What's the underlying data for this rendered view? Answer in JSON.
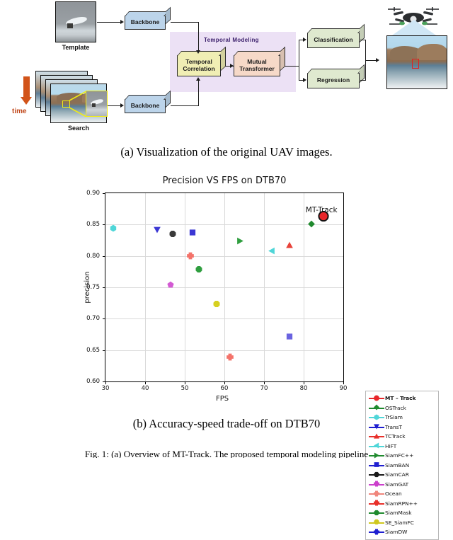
{
  "figure": {
    "panel_a_caption": "(a) Visualization of the original UAV images.",
    "panel_b_caption": "(b) Accuracy-speed trade-off on DTB70",
    "bottom_caption": "Fig. 1: (a) Overview of MT-Track. The proposed temporal modeling pipeline"
  },
  "diagram": {
    "template_label": "Template",
    "search_label": "Search",
    "time_label": "time",
    "backbone_top_label": "Backbone",
    "backbone_bottom_label": "Backbone",
    "temporal_modeling_title": "Temporal  Modeling",
    "temporal_correlation_label": "Temporal\nCorrelation",
    "mutual_transformer_label": "Mutual\nTransformer",
    "classification_label": "Classification",
    "regression_label": "Regression",
    "colors": {
      "backbone": "#bcd4ea",
      "temporal_correlation": "#f0eeb4",
      "mutual_transformer": "#f6d9c8",
      "head": "#dfe9cf",
      "temporal_panel": "#ece1f5",
      "time_arrow": "#d2541a",
      "crop_box": "#f2ec12",
      "target_box": "#e02020"
    }
  },
  "chart_data": {
    "type": "scatter",
    "title": "Precision VS FPS on DTB70",
    "xlabel": "FPS",
    "ylabel": "precision",
    "xlim": [
      30,
      90
    ],
    "ylim": [
      0.6,
      0.9
    ],
    "xticks": [
      30,
      40,
      50,
      60,
      70,
      80,
      90
    ],
    "yticks": [
      0.6,
      0.65,
      0.7,
      0.75,
      0.8,
      0.85,
      0.9
    ],
    "grid": true,
    "legend_position": "right-outside",
    "annotations": [
      {
        "text": "MT-Track",
        "x": 84.5,
        "y": 0.872
      }
    ],
    "highlight": {
      "name": "MT - Track",
      "outline": "#111111"
    },
    "points": [
      {
        "name": "MT - Track",
        "x": 85.0,
        "y": 0.861,
        "color": "#e8262a",
        "marker": "circle",
        "highlighted": true
      },
      {
        "name": "OSTrack",
        "x": 82.0,
        "y": 0.849,
        "color": "#1f8a2e",
        "marker": "diamond"
      },
      {
        "name": "TrSiam",
        "x": 32.0,
        "y": 0.842,
        "color": "#4fd6d8",
        "marker": "hexagon"
      },
      {
        "name": "TransT",
        "x": 43.0,
        "y": 0.84,
        "color": "#3b37d4",
        "marker": "triangle-down"
      },
      {
        "name": "TCTrack",
        "x": 76.5,
        "y": 0.815,
        "color": "#e8433a",
        "marker": "triangle-up"
      },
      {
        "name": "HiFT",
        "x": 72.0,
        "y": 0.806,
        "color": "#4fd6d8",
        "marker": "triangle-left"
      },
      {
        "name": "SiamFC++",
        "x": 64.0,
        "y": 0.822,
        "color": "#2f9e3f",
        "marker": "triangle-right"
      },
      {
        "name": "SiamBAN",
        "x": 52.0,
        "y": 0.836,
        "color": "#3b37d4",
        "marker": "square"
      },
      {
        "name": "SiamCAR",
        "x": 47.0,
        "y": 0.834,
        "color": "#3a3a3a",
        "marker": "octagon"
      },
      {
        "name": "SiamGAT",
        "x": 46.5,
        "y": 0.752,
        "color": "#d35ad3",
        "marker": "pentagon"
      },
      {
        "name": "Ocean",
        "x": 51.5,
        "y": 0.798,
        "color": "#f4726a",
        "marker": "plus-filled"
      },
      {
        "name": "SiamRPN++",
        "x": 61.5,
        "y": 0.637,
        "color": "#f4726a",
        "marker": "plus-filled"
      },
      {
        "name": "SiamMask",
        "x": 53.5,
        "y": 0.777,
        "color": "#2f9e3f",
        "marker": "octagon"
      },
      {
        "name": "SE_SiamFC",
        "x": 58.0,
        "y": 0.722,
        "color": "#d6d020",
        "marker": "octagon"
      },
      {
        "name": "SiamDW",
        "x": 76.5,
        "y": 0.67,
        "color": "#6a63e0",
        "marker": "square"
      }
    ],
    "legend": [
      {
        "label": "MT – Track",
        "color": "#e8262a",
        "marker": "circle",
        "bold": true
      },
      {
        "label": "OSTrack",
        "color": "#1f8a2e",
        "marker": "diamond",
        "bold": false
      },
      {
        "label": "TrSiam",
        "color": "#4fd6d8",
        "marker": "hexagon",
        "bold": false
      },
      {
        "label": "TransT",
        "color": "#1f1fd0",
        "marker": "triangle-down",
        "bold": false
      },
      {
        "label": "TCTrack",
        "color": "#e8302a",
        "marker": "triangle-up",
        "bold": false
      },
      {
        "label": "HiFT",
        "color": "#4fd6d8",
        "marker": "triangle-left",
        "bold": false
      },
      {
        "label": "SiamFC++",
        "color": "#1f8a2e",
        "marker": "triangle-right",
        "bold": false
      },
      {
        "label": "SiamBAN",
        "color": "#1f1fd0",
        "marker": "square",
        "bold": false
      },
      {
        "label": "SiamCAR",
        "color": "#1a1a1a",
        "marker": "octagon",
        "bold": false
      },
      {
        "label": "SiamGAT",
        "color": "#cc3fcc",
        "marker": "plus-filled",
        "bold": false
      },
      {
        "label": "Ocean",
        "color": "#f0867c",
        "marker": "plus-filled",
        "bold": false
      },
      {
        "label": "SiamRPN++",
        "color": "#e8302a",
        "marker": "plus-filled",
        "bold": false
      },
      {
        "label": "SiamMask",
        "color": "#1f8a2e",
        "marker": "octagon",
        "bold": false
      },
      {
        "label": "SE_SiamFC",
        "color": "#cfc81e",
        "marker": "octagon",
        "bold": false
      },
      {
        "label": "SiamDW",
        "color": "#1f1fd0",
        "marker": "plus-filled",
        "bold": false
      }
    ]
  }
}
